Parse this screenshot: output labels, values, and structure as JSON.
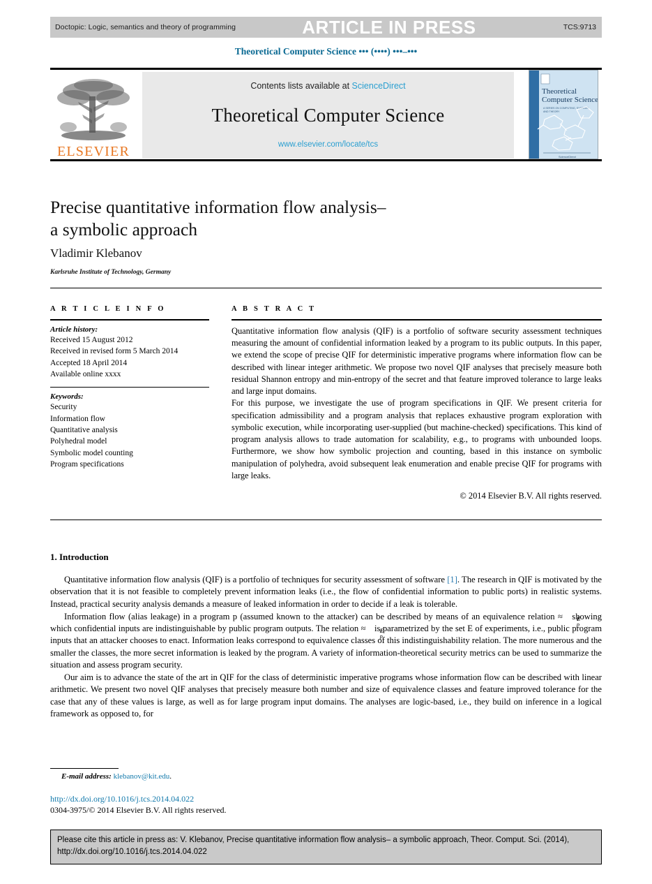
{
  "press_bar": {
    "doctopic": "Doctopic: Logic, semantics and theory of programming",
    "status": "ARTICLE IN PRESS",
    "tcs_number": "TCS:9713"
  },
  "running_head": "Theoretical Computer Science ••• (••••) •••–•••",
  "masthead": {
    "publisher": "ELSEVIER",
    "contents_prefix": "Contents lists available at ",
    "contents_link": "ScienceDirect",
    "journal_title": "Theoretical Computer Science",
    "journal_url": "www.elsevier.com/locate/tcs",
    "cover_title_line1": "Theoretical",
    "cover_title_line2": "Computer Science"
  },
  "article": {
    "title_line1": "Precise quantitative information flow analysis–",
    "title_line2": "a symbolic approach",
    "author": "Vladimir Klebanov",
    "affiliation": "Karlsruhe Institute of Technology, Germany"
  },
  "info": {
    "heading": "A R T I C L E    I N F O",
    "history_label": "Article history:",
    "history": [
      "Received 15 August 2012",
      "Received in revised form 5 March 2014",
      "Accepted 18 April 2014",
      "Available online xxxx"
    ],
    "keywords_label": "Keywords:",
    "keywords": [
      "Security",
      "Information flow",
      "Quantitative analysis",
      "Polyhedral model",
      "Symbolic model counting",
      "Program specifications"
    ]
  },
  "abstract": {
    "heading": "A B S T R A C T",
    "paragraph1": "Quantitative information flow analysis (QIF) is a portfolio of software security assessment techniques measuring the amount of confidential information leaked by a program to its public outputs. In this paper, we extend the scope of precise QIF for deterministic imperative programs where information flow can be described with linear integer arithmetic. We propose two novel QIF analyses that precisely measure both residual Shannon entropy and min-entropy of the secret and that feature improved tolerance to large leaks and large input domains.",
    "paragraph2": "For this purpose, we investigate the use of program specifications in QIF. We present criteria for specification admissibility and a program analysis that replaces exhaustive program exploration with symbolic execution, while incorporating user-supplied (but machine-checked) specifications. This kind of program analysis allows to trade automation for scalability, e.g., to programs with unbounded loops. Furthermore, we show how symbolic projection and counting, based in this instance on symbolic manipulation of polyhedra, avoid subsequent leak enumeration and enable precise QIF for programs with large leaks.",
    "copyright": "© 2014 Elsevier B.V. All rights reserved."
  },
  "introduction": {
    "heading": "1. Introduction",
    "p1_a": "Quantitative information flow analysis (QIF) is a portfolio of techniques for security assessment of software ",
    "p1_cite": "[1]",
    "p1_b": ". The research in QIF is motivated by the observation that it is not feasible to completely prevent information leaks (i.e., the flow of confidential information to public ports) in realistic systems. Instead, practical security analysis demands a measure of leaked information in order to decide if a leak is tolerable.",
    "p2_a": "Information flow (alias leakage) in a program p (assumed known to the attacker) can be described by means of an equivalence relation ≈",
    "p2_b": " showing which confidential inputs are indistinguishable by public program outputs. The relation ≈",
    "p2_c": " is parametrized by the set E of experiments, i.e., public program inputs that an attacker chooses to enact. Information leaks correspond to equivalence classes of this indistinguishability relation. The more numerous and the smaller the classes, the more secret information is leaked by the program. A variety of information-theoretical security metrics can be used to summarize the situation and assess program security.",
    "p2_sup": "E",
    "p2_sub": "p",
    "p3": "Our aim is to advance the state of the art in QIF for the class of deterministic imperative programs whose information flow can be described with linear arithmetic. We present two novel QIF analyses that precisely measure both number and size of equivalence classes and feature improved tolerance for the case that any of these values is large, as well as for large program input domains. The analyses are logic-based, i.e., they build on inference in a logical framework as opposed to, for"
  },
  "footer": {
    "email_label": "E-mail address:",
    "email": "klebanov@kit.edu",
    "email_suffix": ".",
    "doi": "http://dx.doi.org/10.1016/j.tcs.2014.04.022",
    "issn": "0304-3975/© 2014 Elsevier B.V. All rights reserved.",
    "cite_line1": "Please cite this article in press as: V. Klebanov, Precise quantitative information flow analysis– a symbolic approach, Theor. Comput. Sci. (2014),",
    "cite_line2": "http://dx.doi.org/10.1016/j.tcs.2014.04.022"
  },
  "colors": {
    "press_bar_bg": "#c8c8c8",
    "link_blue": "#2a9fd0",
    "running_head_teal": "#0b6a93",
    "elsevier_orange": "#e87722",
    "cite_blue": "#2a7ab0",
    "panel_gray": "#e9e9e9",
    "cite_box_gray": "#c9c9c9"
  }
}
